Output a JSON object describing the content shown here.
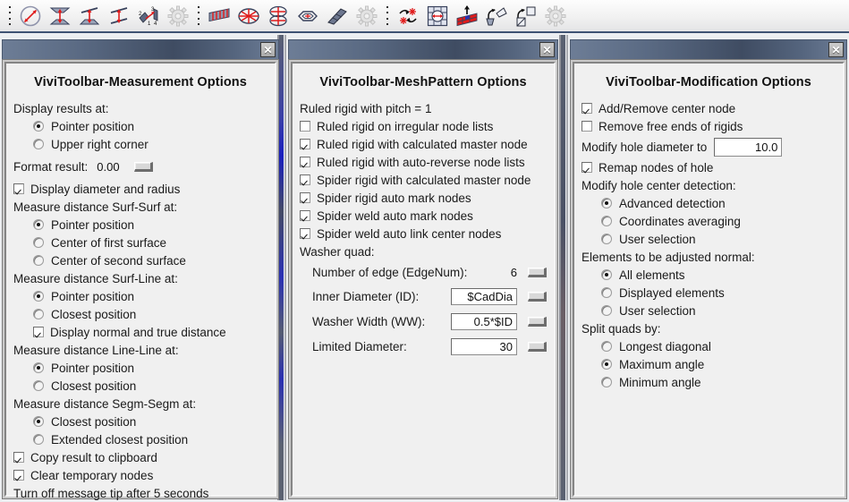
{
  "toolbar": {
    "groups": [
      {
        "name": "measure-group",
        "icons": [
          "measure-diameter-icon",
          "measure-surf-surf-icon",
          "measure-surf-line-icon",
          "measure-line-line-icon",
          "measure-angle-icon",
          "measure-settings-icon"
        ]
      },
      {
        "name": "meshpattern-group",
        "icons": [
          "ruled-rigid-icon",
          "spider-rigid-icon",
          "spider-weld-icon",
          "washer-quad-icon",
          "mesh-wedge-icon",
          "meshpattern-settings-icon"
        ]
      },
      {
        "name": "modification-group",
        "icons": [
          "reverse-normals-icon",
          "hole-diameter-icon",
          "adjust-normal-icon",
          "split-quad-icon",
          "remap-node-icon",
          "modification-settings-icon"
        ]
      }
    ]
  },
  "panels": [
    {
      "name": "measurement",
      "title": "ViviToolbar-Measurement Options",
      "close_label": "✕",
      "rows": [
        {
          "kind": "header",
          "label": "Display results at:"
        },
        {
          "kind": "radio",
          "indent": 1,
          "checked": true,
          "label": "Pointer position"
        },
        {
          "kind": "radio",
          "indent": 1,
          "checked": false,
          "label": "Upper right corner"
        },
        {
          "kind": "format",
          "label": "Format result:",
          "value": "0.00"
        },
        {
          "kind": "check",
          "indent": 0,
          "checked": true,
          "label": "Display diameter and radius"
        },
        {
          "kind": "header",
          "label": "Measure distance Surf-Surf at:"
        },
        {
          "kind": "radio",
          "indent": 1,
          "checked": true,
          "label": "Pointer position"
        },
        {
          "kind": "radio",
          "indent": 1,
          "checked": false,
          "label": "Center of first surface"
        },
        {
          "kind": "radio",
          "indent": 1,
          "checked": false,
          "label": "Center of second surface"
        },
        {
          "kind": "header",
          "label": "Measure distance Surf-Line at:"
        },
        {
          "kind": "radio",
          "indent": 1,
          "checked": true,
          "label": "Pointer position"
        },
        {
          "kind": "radio",
          "indent": 1,
          "checked": false,
          "label": "Closest position"
        },
        {
          "kind": "check",
          "indent": 1,
          "checked": true,
          "label": "Display normal and true distance"
        },
        {
          "kind": "header",
          "label": "Measure distance Line-Line at:"
        },
        {
          "kind": "radio",
          "indent": 1,
          "checked": true,
          "label": "Pointer position"
        },
        {
          "kind": "radio",
          "indent": 1,
          "checked": false,
          "label": "Closest position"
        },
        {
          "kind": "header",
          "label": "Measure distance Segm-Segm at:"
        },
        {
          "kind": "radio",
          "indent": 1,
          "checked": true,
          "label": "Closest position"
        },
        {
          "kind": "radio",
          "indent": 1,
          "checked": false,
          "label": "Extended closest position"
        },
        {
          "kind": "check",
          "indent": 0,
          "checked": true,
          "label": "Copy result to clipboard"
        },
        {
          "kind": "check",
          "indent": 0,
          "checked": true,
          "label": "Clear temporary nodes"
        },
        {
          "kind": "header",
          "label": "Turn off message tip after 5 seconds"
        }
      ]
    },
    {
      "name": "meshpattern",
      "title": "ViviToolbar-MeshPattern Options",
      "close_label": "✕",
      "rows": [
        {
          "kind": "header",
          "label": "Ruled rigid with pitch = 1"
        },
        {
          "kind": "check",
          "indent": 0,
          "checked": false,
          "label": "Ruled rigid on irregular node lists"
        },
        {
          "kind": "check",
          "indent": 0,
          "checked": true,
          "label": "Ruled rigid with calculated master node"
        },
        {
          "kind": "check",
          "indent": 0,
          "checked": true,
          "label": "Ruled rigid with auto-reverse node lists"
        },
        {
          "kind": "check",
          "indent": 0,
          "checked": true,
          "label": "Spider rigid with calculated master node"
        },
        {
          "kind": "check",
          "indent": 0,
          "checked": true,
          "label": "Spider rigid auto mark nodes"
        },
        {
          "kind": "check",
          "indent": 0,
          "checked": true,
          "label": "Spider weld auto mark nodes"
        },
        {
          "kind": "check",
          "indent": 0,
          "checked": true,
          "label": "Spider weld auto link center nodes"
        },
        {
          "kind": "header",
          "label": "Washer quad:"
        },
        {
          "kind": "plainfield",
          "label": "Number of edge (EdgeNum):",
          "value": "6"
        },
        {
          "kind": "inputfield",
          "label": "Inner Diameter (ID):",
          "value": "$CadDia"
        },
        {
          "kind": "inputfield",
          "label": "Washer Width (WW):",
          "value": "0.5*$ID"
        },
        {
          "kind": "inputfield",
          "label": "Limited Diameter:",
          "value": "30"
        }
      ]
    },
    {
      "name": "modification",
      "title": "ViviToolbar-Modification Options",
      "close_label": "✕",
      "rows": [
        {
          "kind": "check",
          "indent": 0,
          "checked": true,
          "label": "Add/Remove center node"
        },
        {
          "kind": "check",
          "indent": 0,
          "checked": false,
          "label": "Remove free ends of rigids"
        },
        {
          "kind": "holefield",
          "label": "Modify hole diameter to",
          "value": "10.0"
        },
        {
          "kind": "check",
          "indent": 0,
          "checked": true,
          "label": "Remap nodes of hole"
        },
        {
          "kind": "header",
          "label": "Modify hole center detection:"
        },
        {
          "kind": "radio",
          "indent": 1,
          "checked": true,
          "label": "Advanced detection"
        },
        {
          "kind": "radio",
          "indent": 1,
          "checked": false,
          "label": "Coordinates averaging"
        },
        {
          "kind": "radio",
          "indent": 1,
          "checked": false,
          "label": "User selection"
        },
        {
          "kind": "header",
          "label": "Elements to be adjusted normal:"
        },
        {
          "kind": "radio",
          "indent": 1,
          "checked": true,
          "label": "All elements"
        },
        {
          "kind": "radio",
          "indent": 1,
          "checked": false,
          "label": "Displayed elements"
        },
        {
          "kind": "radio",
          "indent": 1,
          "checked": false,
          "label": "User selection"
        },
        {
          "kind": "header",
          "label": "Split quads by:"
        },
        {
          "kind": "radio",
          "indent": 1,
          "checked": false,
          "label": "Longest diagonal"
        },
        {
          "kind": "radio",
          "indent": 1,
          "checked": true,
          "label": "Maximum angle"
        },
        {
          "kind": "radio",
          "indent": 1,
          "checked": false,
          "label": "Minimum angle"
        }
      ]
    }
  ],
  "colors": {
    "titlebar": "#4a586e",
    "panel_bg": "#f0f0f0",
    "toolbar_bg": "#f1f1f1",
    "accent_red": "#e01b1b",
    "icon_blue": "#3d4a66"
  }
}
